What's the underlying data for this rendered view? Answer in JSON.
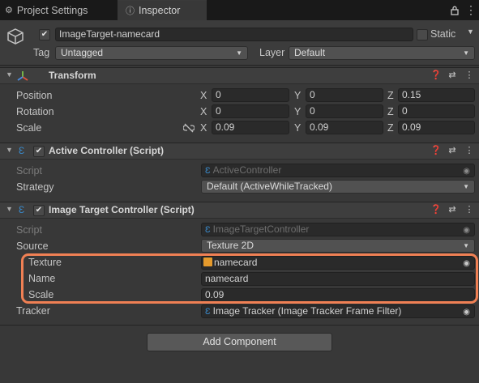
{
  "tabs": {
    "project_settings": "Project Settings",
    "inspector": "Inspector",
    "lock_icon": "lock-icon",
    "more_icon": "kebab-menu-icon"
  },
  "object": {
    "name": "ImageTarget-namecard",
    "static_label": "Static",
    "tag_label": "Tag",
    "tag_value": "Untagged",
    "layer_label": "Layer",
    "layer_value": "Default",
    "active": true,
    "static": false
  },
  "transform": {
    "title": "Transform",
    "rows": [
      {
        "label": "Position",
        "x": "0",
        "y": "0",
        "z": "0.15"
      },
      {
        "label": "Rotation",
        "x": "0",
        "y": "0",
        "z": "0"
      },
      {
        "label": "Scale",
        "x": "0.09",
        "y": "0.09",
        "z": "0.09"
      }
    ],
    "axis_x": "X",
    "axis_y": "Y",
    "axis_z": "Z"
  },
  "active_controller": {
    "title": "Active Controller (Script)",
    "enabled": true,
    "script_label": "Script",
    "script_value": "ActiveController",
    "strategy_label": "Strategy",
    "strategy_value": "Default (ActiveWhileTracked)"
  },
  "image_target_controller": {
    "title": "Image Target Controller (Script)",
    "enabled": true,
    "script_label": "Script",
    "script_value": "ImageTargetController",
    "source_label": "Source",
    "source_value": "Texture 2D",
    "texture_label": "Texture",
    "texture_value": "namecard",
    "name_label": "Name",
    "name_value": "namecard",
    "scale_label": "Scale",
    "scale_value": "0.09",
    "tracker_label": "Tracker",
    "tracker_value": "Image Tracker (Image Tracker Frame Filter)"
  },
  "add_component": "Add Component",
  "colors": {
    "highlight": "#f08054",
    "script_icon": "#3a89c9",
    "background": "#383838"
  }
}
